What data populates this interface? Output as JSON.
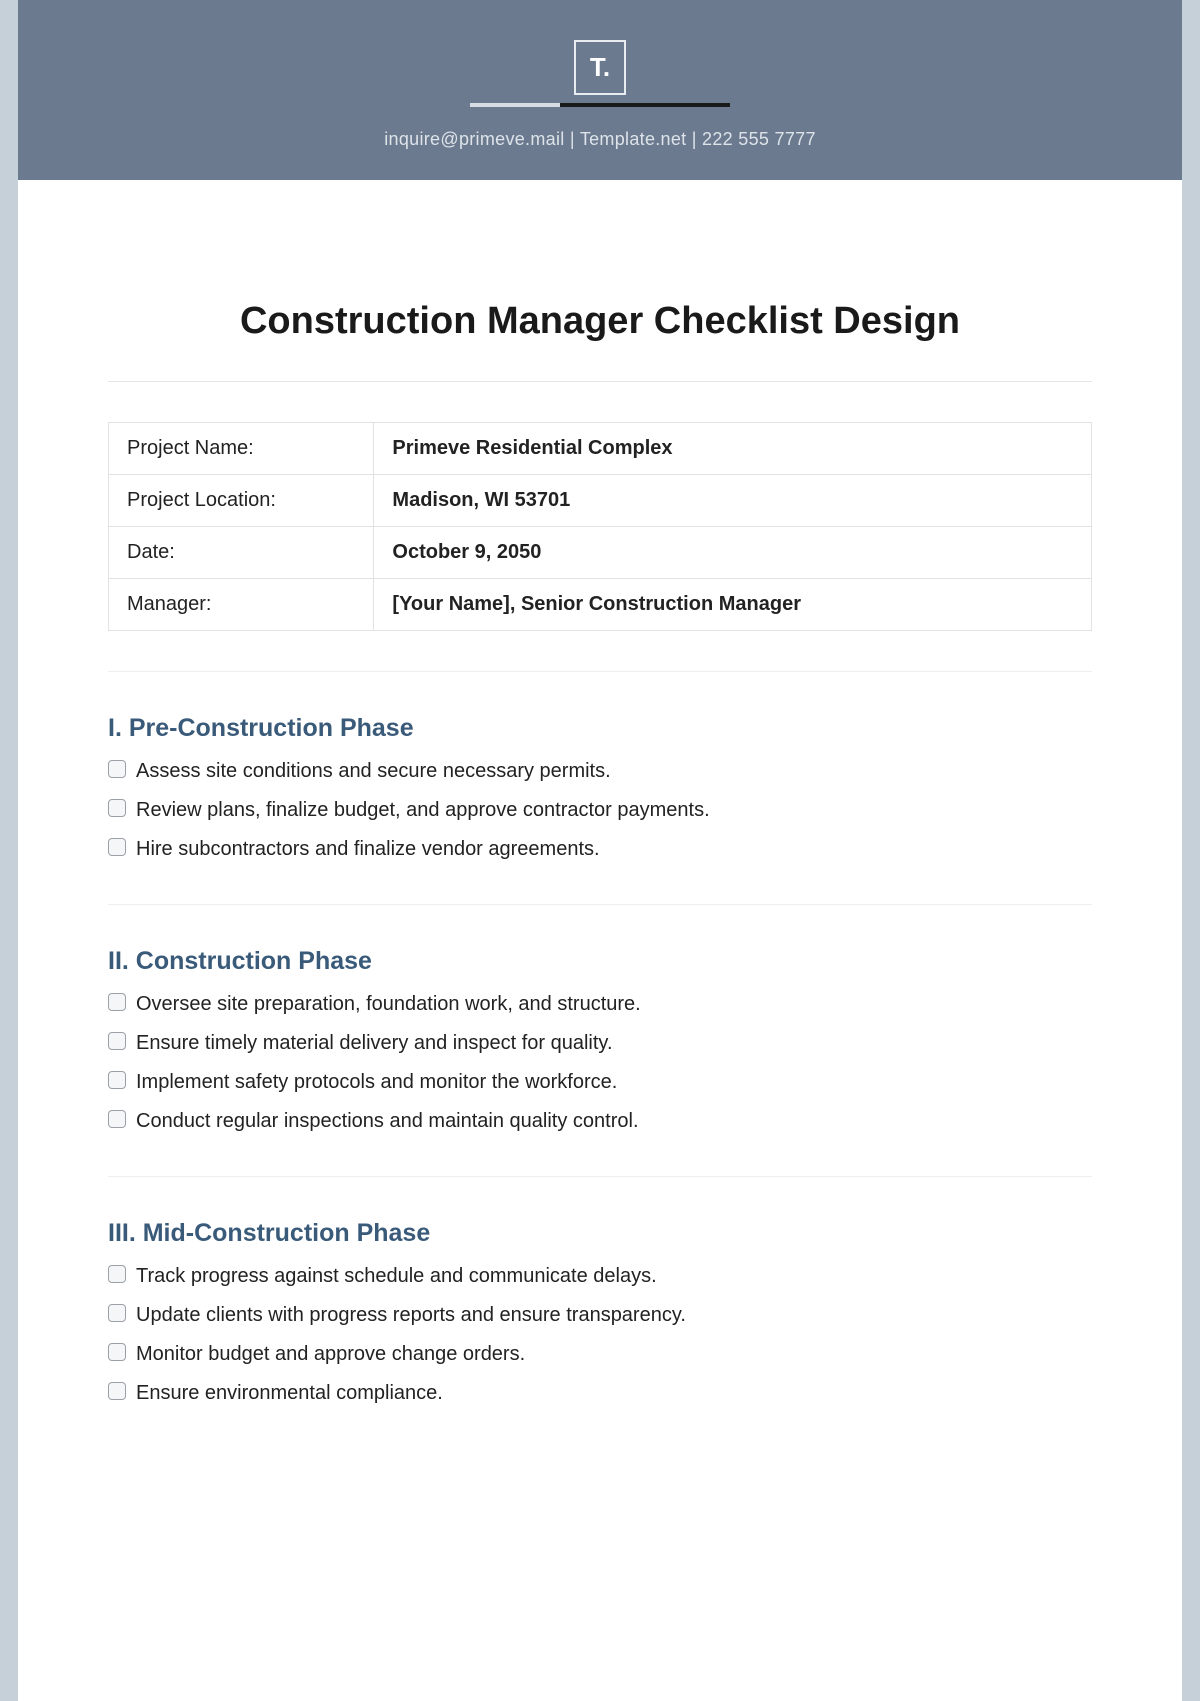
{
  "header": {
    "logo_text": "T.",
    "contact": "inquire@primeve.mail  |  Template.net  |  222 555 7777"
  },
  "title": "Construction Manager Checklist Design",
  "info": [
    {
      "label": "Project Name:",
      "value": "Primeve Residential Complex"
    },
    {
      "label": "Project Location:",
      "value": "Madison, WI 53701"
    },
    {
      "label": "Date:",
      "value": "October 9, 2050"
    },
    {
      "label": "Manager:",
      "value": "[Your Name], Senior Construction Manager"
    }
  ],
  "sections": [
    {
      "title": "I. Pre-Construction Phase",
      "items": [
        "Assess site conditions and secure necessary permits.",
        "Review plans, finalize budget, and approve contractor payments.",
        "Hire subcontractors and finalize vendor agreements."
      ]
    },
    {
      "title": "II. Construction Phase",
      "items": [
        "Oversee site preparation, foundation work, and structure.",
        "Ensure timely material delivery and inspect for quality.",
        "Implement safety protocols and monitor the workforce.",
        "Conduct regular inspections and maintain quality control."
      ]
    },
    {
      "title": "III. Mid-Construction Phase",
      "items": [
        "Track progress against schedule and communicate delays.",
        "Update clients with progress reports and ensure transparency.",
        "Monitor budget and approve change orders.",
        "Ensure environmental compliance."
      ]
    }
  ]
}
